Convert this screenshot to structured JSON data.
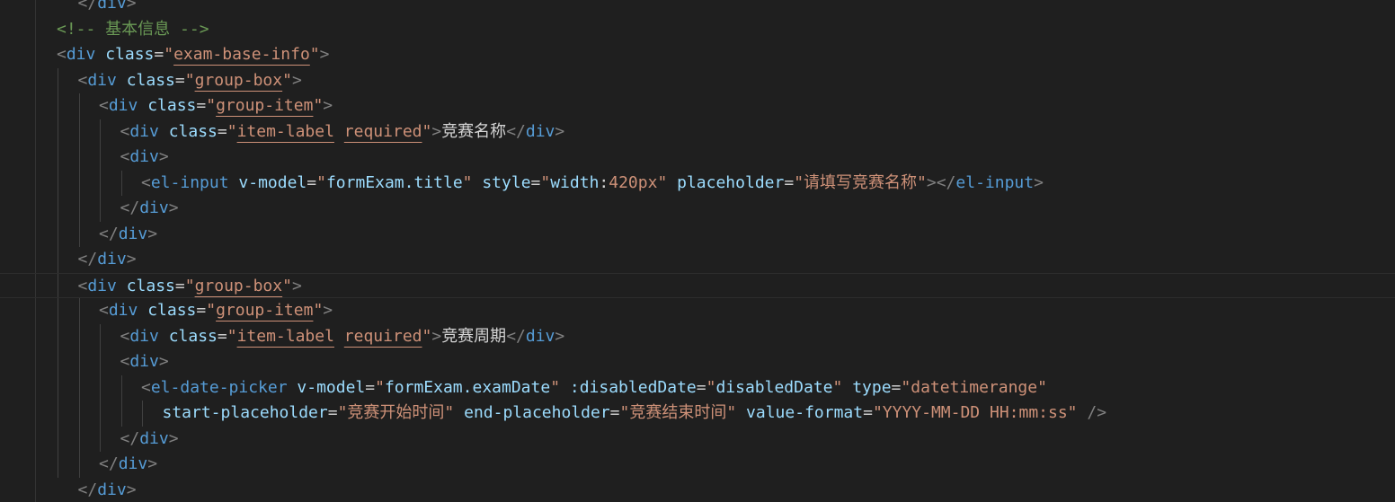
{
  "editor": {
    "language": "html",
    "theme": "dark",
    "colors": {
      "background": "#1f1f1f",
      "tag": "#569cd6",
      "attribute": "#9cdcfe",
      "string": "#ce9178",
      "comment": "#6a9955",
      "punctuation": "#808080",
      "text": "#d4d4d4"
    },
    "lines": [
      {
        "indent": 3,
        "tokens": [
          [
            "punct",
            "</"
          ],
          [
            "tag",
            "div"
          ],
          [
            "punct",
            ">"
          ]
        ]
      },
      {
        "indent": 2,
        "tokens": [
          [
            "comment",
            "<!-- 基本信息 -->"
          ]
        ]
      },
      {
        "indent": 2,
        "tokens": [
          [
            "punct",
            "<"
          ],
          [
            "tag",
            "div"
          ],
          [
            "text",
            " "
          ],
          [
            "attr",
            "class"
          ],
          [
            "eq",
            "="
          ],
          [
            "str",
            "\""
          ],
          [
            "str-u",
            "exam-base-info"
          ],
          [
            "str",
            "\""
          ],
          [
            "punct",
            ">"
          ]
        ]
      },
      {
        "indent": 3,
        "tokens": [
          [
            "punct",
            "<"
          ],
          [
            "tag",
            "div"
          ],
          [
            "text",
            " "
          ],
          [
            "attr",
            "class"
          ],
          [
            "eq",
            "="
          ],
          [
            "str",
            "\""
          ],
          [
            "str-u",
            "group-box"
          ],
          [
            "str",
            "\""
          ],
          [
            "punct",
            ">"
          ]
        ]
      },
      {
        "indent": 4,
        "tokens": [
          [
            "punct",
            "<"
          ],
          [
            "tag",
            "div"
          ],
          [
            "text",
            " "
          ],
          [
            "attr",
            "class"
          ],
          [
            "eq",
            "="
          ],
          [
            "str",
            "\""
          ],
          [
            "str-u",
            "group-item"
          ],
          [
            "str",
            "\""
          ],
          [
            "punct",
            ">"
          ]
        ]
      },
      {
        "indent": 5,
        "tokens": [
          [
            "punct",
            "<"
          ],
          [
            "tag",
            "div"
          ],
          [
            "text",
            " "
          ],
          [
            "attr",
            "class"
          ],
          [
            "eq",
            "="
          ],
          [
            "str",
            "\""
          ],
          [
            "str-u",
            "item-label"
          ],
          [
            "str",
            " "
          ],
          [
            "str-u",
            "required"
          ],
          [
            "str",
            "\""
          ],
          [
            "punct",
            ">"
          ],
          [
            "text",
            "竞赛名称"
          ],
          [
            "punct",
            "</"
          ],
          [
            "tag",
            "div"
          ],
          [
            "punct",
            ">"
          ]
        ]
      },
      {
        "indent": 5,
        "tokens": [
          [
            "punct",
            "<"
          ],
          [
            "tag",
            "div"
          ],
          [
            "punct",
            ">"
          ]
        ]
      },
      {
        "indent": 6,
        "tokens": [
          [
            "punct",
            "<"
          ],
          [
            "tag",
            "el-input"
          ],
          [
            "text",
            " "
          ],
          [
            "attr",
            "v-model"
          ],
          [
            "eq",
            "="
          ],
          [
            "str",
            "\""
          ],
          [
            "attr",
            "formExam.title"
          ],
          [
            "str",
            "\""
          ],
          [
            "text",
            " "
          ],
          [
            "attr",
            "style"
          ],
          [
            "eq",
            "="
          ],
          [
            "str",
            "\""
          ],
          [
            "attr",
            "width"
          ],
          [
            "text",
            ":"
          ],
          [
            "str",
            "420px"
          ],
          [
            "str",
            "\""
          ],
          [
            "text",
            " "
          ],
          [
            "attr",
            "placeholder"
          ],
          [
            "eq",
            "="
          ],
          [
            "str",
            "\"请填写竞赛名称\""
          ],
          [
            "punct",
            "></"
          ],
          [
            "tag",
            "el-input"
          ],
          [
            "punct",
            ">"
          ]
        ]
      },
      {
        "indent": 5,
        "tokens": [
          [
            "punct",
            "</"
          ],
          [
            "tag",
            "div"
          ],
          [
            "punct",
            ">"
          ]
        ]
      },
      {
        "indent": 4,
        "tokens": [
          [
            "punct",
            "</"
          ],
          [
            "tag",
            "div"
          ],
          [
            "punct",
            ">"
          ]
        ]
      },
      {
        "indent": 3,
        "tokens": [
          [
            "punct",
            "</"
          ],
          [
            "tag",
            "div"
          ],
          [
            "punct",
            ">"
          ]
        ]
      },
      {
        "indent": 3,
        "current": true,
        "tokens": [
          [
            "punct",
            "<"
          ],
          [
            "tag",
            "div"
          ],
          [
            "text",
            " "
          ],
          [
            "attr",
            "class"
          ],
          [
            "eq",
            "="
          ],
          [
            "str",
            "\""
          ],
          [
            "str-u",
            "group-box"
          ],
          [
            "str",
            "\""
          ],
          [
            "punct",
            ">"
          ]
        ]
      },
      {
        "indent": 4,
        "tokens": [
          [
            "punct",
            "<"
          ],
          [
            "tag",
            "div"
          ],
          [
            "text",
            " "
          ],
          [
            "attr",
            "class"
          ],
          [
            "eq",
            "="
          ],
          [
            "str",
            "\""
          ],
          [
            "str-u",
            "group-item"
          ],
          [
            "str",
            "\""
          ],
          [
            "punct",
            ">"
          ]
        ]
      },
      {
        "indent": 5,
        "tokens": [
          [
            "punct",
            "<"
          ],
          [
            "tag",
            "div"
          ],
          [
            "text",
            " "
          ],
          [
            "attr",
            "class"
          ],
          [
            "eq",
            "="
          ],
          [
            "str",
            "\""
          ],
          [
            "str-u",
            "item-label"
          ],
          [
            "str",
            " "
          ],
          [
            "str-u",
            "required"
          ],
          [
            "str",
            "\""
          ],
          [
            "punct",
            ">"
          ],
          [
            "text",
            "竞赛周期"
          ],
          [
            "punct",
            "</"
          ],
          [
            "tag",
            "div"
          ],
          [
            "punct",
            ">"
          ]
        ]
      },
      {
        "indent": 5,
        "tokens": [
          [
            "punct",
            "<"
          ],
          [
            "tag",
            "div"
          ],
          [
            "punct",
            ">"
          ]
        ]
      },
      {
        "indent": 6,
        "tokens": [
          [
            "punct",
            "<"
          ],
          [
            "tag",
            "el-date-picker"
          ],
          [
            "text",
            " "
          ],
          [
            "attr",
            "v-model"
          ],
          [
            "eq",
            "="
          ],
          [
            "str",
            "\""
          ],
          [
            "attr",
            "formExam.examDate"
          ],
          [
            "str",
            "\""
          ],
          [
            "text",
            " "
          ],
          [
            "attr",
            ":disabledDate"
          ],
          [
            "eq",
            "="
          ],
          [
            "str",
            "\""
          ],
          [
            "attr",
            "disabledDate"
          ],
          [
            "str",
            "\""
          ],
          [
            "text",
            " "
          ],
          [
            "attr",
            "type"
          ],
          [
            "eq",
            "="
          ],
          [
            "str",
            "\"datetimerange\""
          ]
        ]
      },
      {
        "indent": 7,
        "tokens": [
          [
            "attr",
            "start-placeholder"
          ],
          [
            "eq",
            "="
          ],
          [
            "str",
            "\"竞赛开始时间\""
          ],
          [
            "text",
            " "
          ],
          [
            "attr",
            "end-placeholder"
          ],
          [
            "eq",
            "="
          ],
          [
            "str",
            "\"竞赛结束时间\""
          ],
          [
            "text",
            " "
          ],
          [
            "attr",
            "value-format"
          ],
          [
            "eq",
            "="
          ],
          [
            "str",
            "\"YYYY-MM-DD HH:mm:ss\""
          ],
          [
            "text",
            " "
          ],
          [
            "punct",
            "/>"
          ]
        ]
      },
      {
        "indent": 5,
        "tokens": [
          [
            "punct",
            "</"
          ],
          [
            "tag",
            "div"
          ],
          [
            "punct",
            ">"
          ]
        ]
      },
      {
        "indent": 4,
        "tokens": [
          [
            "punct",
            "</"
          ],
          [
            "tag",
            "div"
          ],
          [
            "punct",
            ">"
          ]
        ]
      },
      {
        "indent": 3,
        "tokens": [
          [
            "punct",
            "</"
          ],
          [
            "tag",
            "div"
          ],
          [
            "punct",
            ">"
          ]
        ]
      }
    ]
  }
}
